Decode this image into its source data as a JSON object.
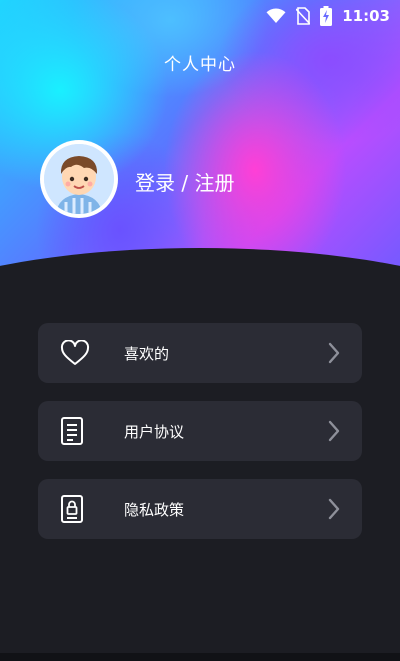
{
  "status_bar": {
    "time": "11:03",
    "icons": [
      "wifi-icon",
      "no-sim-icon",
      "battery-charging-icon"
    ]
  },
  "header": {
    "title": "个人中心"
  },
  "profile": {
    "login_text": "登录 / 注册",
    "avatar": "avatar-illustration"
  },
  "menu": [
    {
      "label": "喜欢的",
      "icon": "heart-icon"
    },
    {
      "label": "用户协议",
      "icon": "document-icon"
    },
    {
      "label": "隐私政策",
      "icon": "privacy-lock-icon"
    }
  ],
  "colors": {
    "background": "#1c1d23",
    "card": "#2b2c35",
    "text": "#ffffff",
    "chevron": "#8e909a"
  }
}
